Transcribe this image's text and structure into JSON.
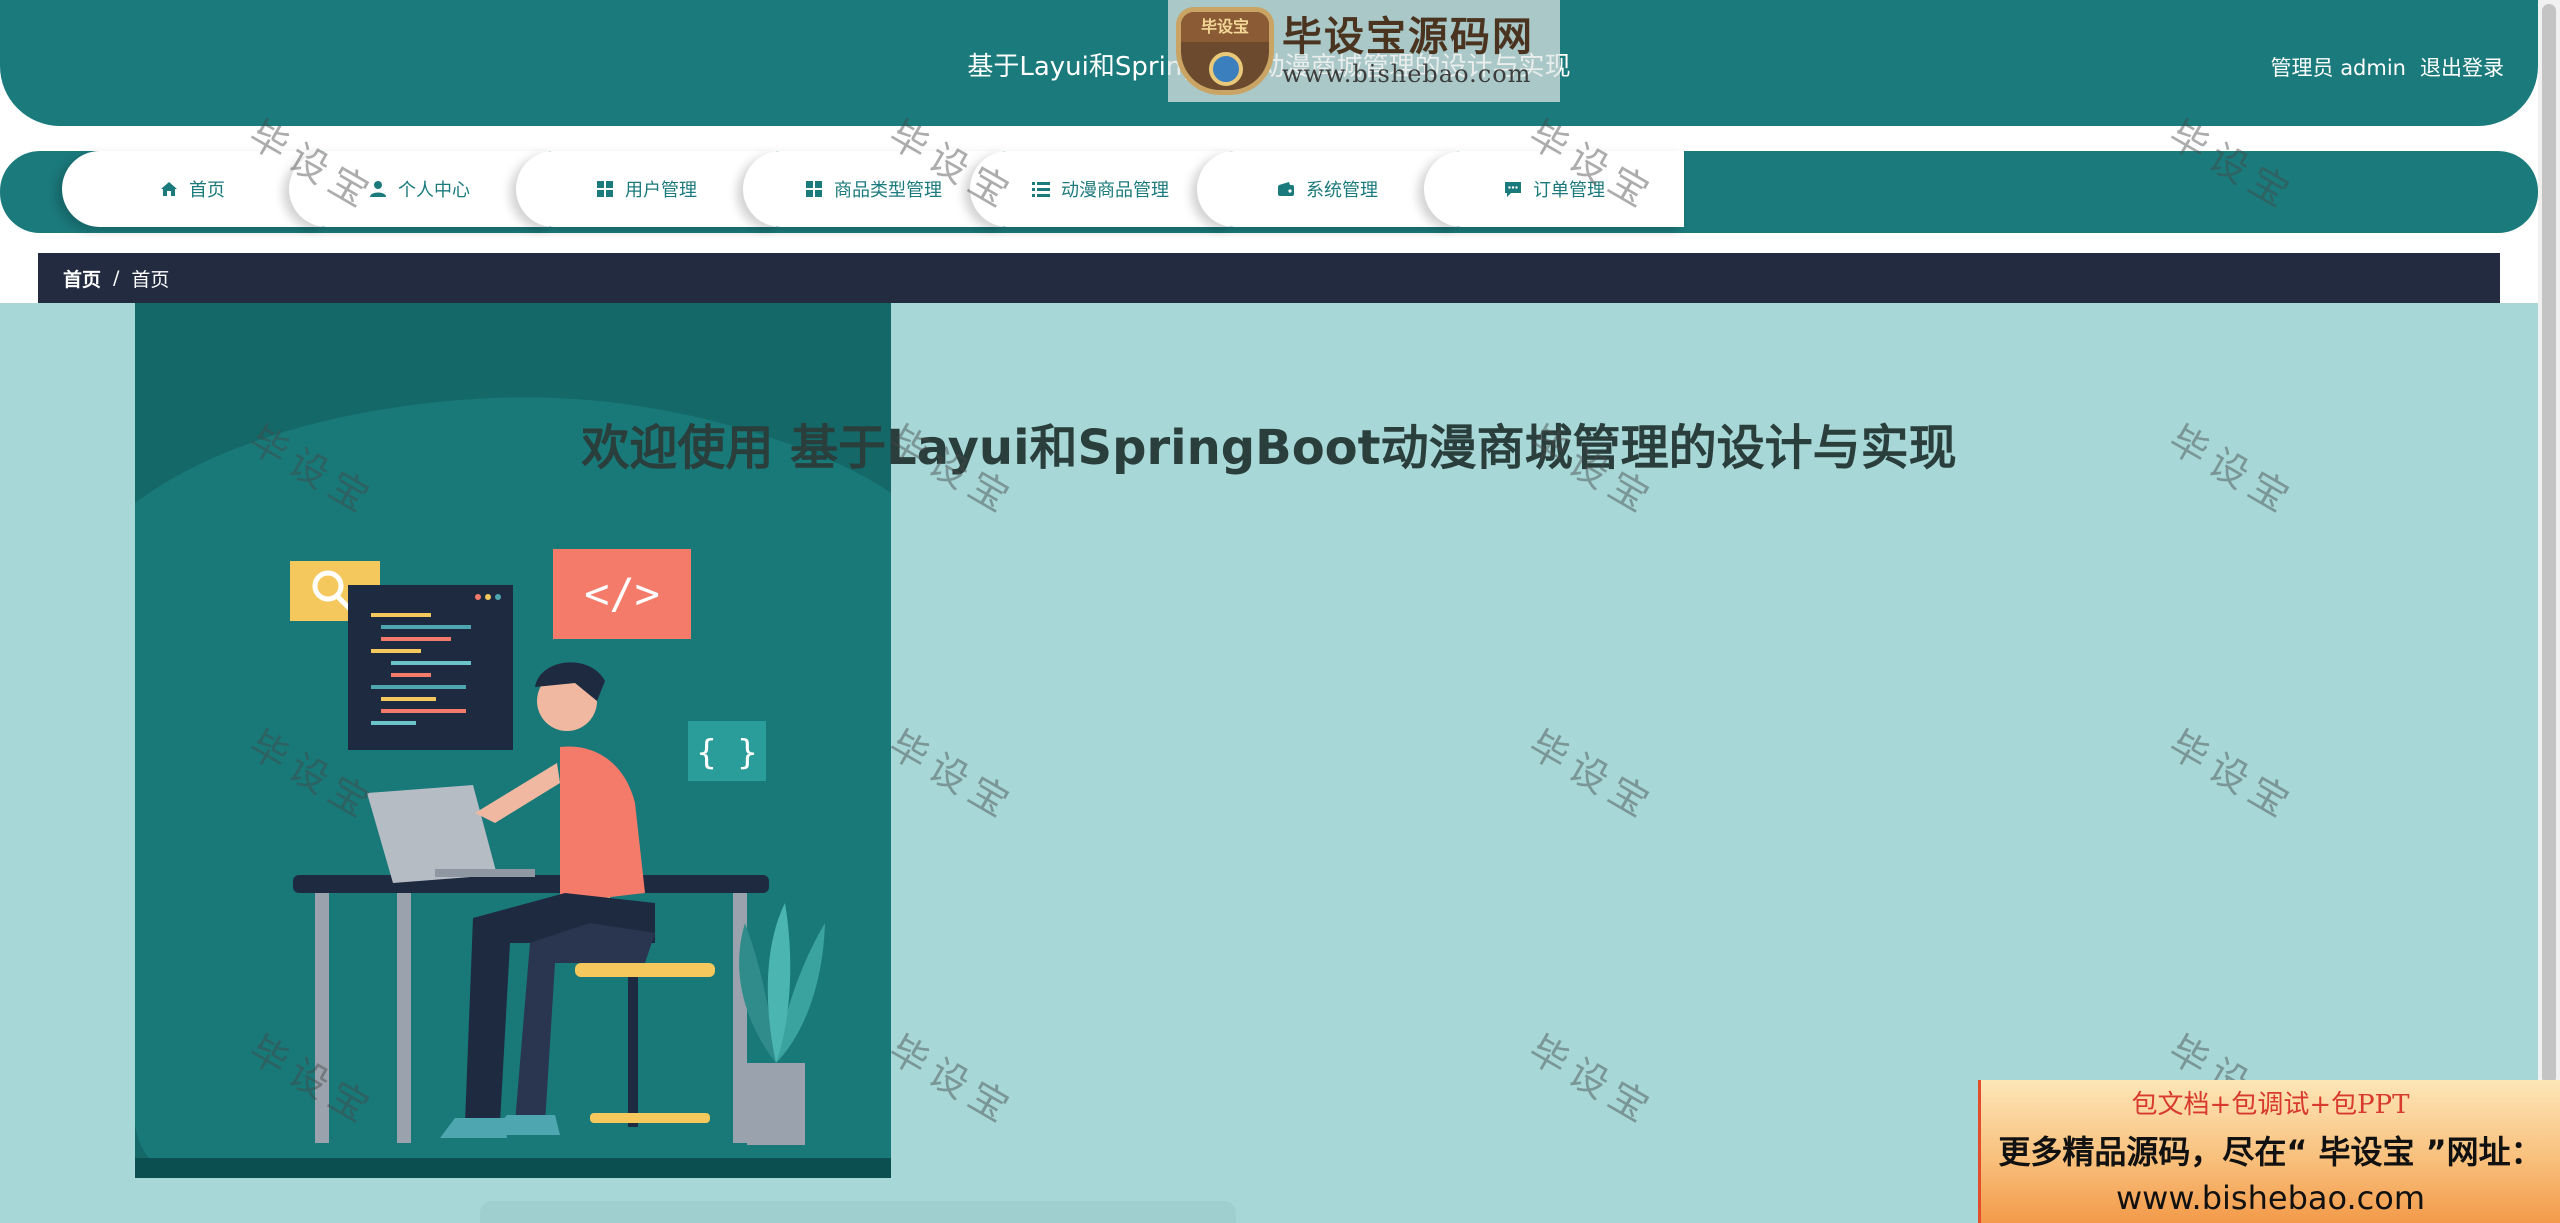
{
  "header": {
    "title": "基于Layui和SpringBoot动漫商城管理的设计与实现",
    "role_label": "管理员 admin",
    "logout_label": "退出登录"
  },
  "logo": {
    "badge_text": "毕设宝",
    "main_text": "毕设宝源码网",
    "url_text": "www.bishebao.com"
  },
  "nav": {
    "items": [
      {
        "label": "首页",
        "icon": "home-icon"
      },
      {
        "label": "个人中心",
        "icon": "user-icon"
      },
      {
        "label": "用户管理",
        "icon": "grid-icon"
      },
      {
        "label": "商品类型管理",
        "icon": "grid-icon"
      },
      {
        "label": "动漫商品管理",
        "icon": "list-icon"
      },
      {
        "label": "系统管理",
        "icon": "wallet-icon"
      },
      {
        "label": "订单管理",
        "icon": "chat-icon"
      }
    ]
  },
  "breadcrumb": {
    "first": "首页",
    "separator": "/",
    "current": "首页"
  },
  "main": {
    "welcome": "欢迎使用 基于Layui和SpringBoot动漫商城管理的设计与实现"
  },
  "watermark": {
    "text": "毕设宝"
  },
  "ad": {
    "line1": "包文档+包调试+包PPT",
    "line2": "更多精品源码，尽在“ 毕设宝 ”网址：",
    "line3": "www.bishebao.com"
  },
  "colors": {
    "primary": "#1b7a7c",
    "breadcrumb_bg": "#222b40",
    "main_bg": "#a7d7d7"
  }
}
